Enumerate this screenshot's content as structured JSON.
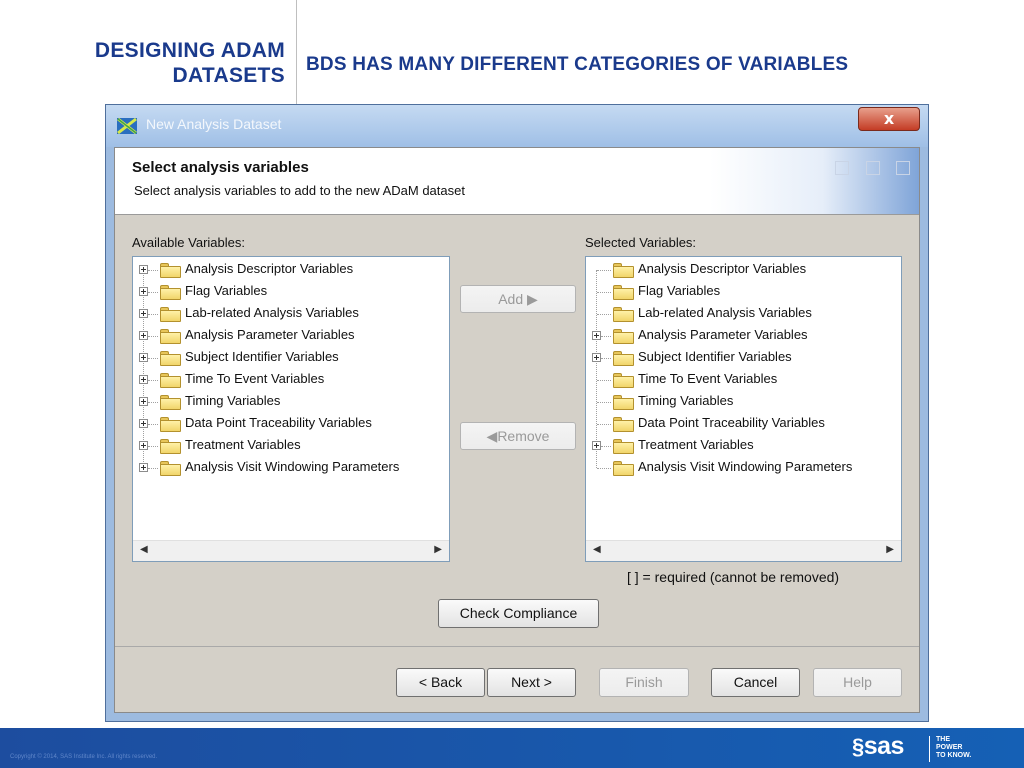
{
  "slide": {
    "left_title_line1": "DESIGNING ADAM",
    "left_title_line2": "DATASETS",
    "right_title": "BDS HAS MANY DIFFERENT CATEGORIES OF VARIABLES",
    "copyright": "Copyright © 2014, SAS Institute Inc. All rights reserved.",
    "logo_text": "sas",
    "tagline_line1": "THE",
    "tagline_line2": "POWER",
    "tagline_line3": "TO KNOW."
  },
  "window": {
    "title": "New Analysis Dataset",
    "close_label": "x"
  },
  "banner": {
    "title": "Select analysis variables",
    "subtitle": "Select analysis variables to add to the new ADaM dataset"
  },
  "available": {
    "label": "Available Variables:",
    "items": [
      {
        "label": "Analysis Descriptor Variables",
        "expandable": true
      },
      {
        "label": "Flag Variables",
        "expandable": true
      },
      {
        "label": "Lab-related Analysis Variables",
        "expandable": true
      },
      {
        "label": "Analysis Parameter Variables",
        "expandable": true
      },
      {
        "label": "Subject Identifier Variables",
        "expandable": true
      },
      {
        "label": "Time To Event Variables",
        "expandable": true
      },
      {
        "label": "Timing Variables",
        "expandable": true
      },
      {
        "label": "Data Point Traceability Variables",
        "expandable": true
      },
      {
        "label": "Treatment Variables",
        "expandable": true
      },
      {
        "label": "Analysis Visit Windowing Parameters",
        "expandable": true
      }
    ]
  },
  "selected": {
    "label": "Selected Variables:",
    "items": [
      {
        "label": "Analysis Descriptor Variables",
        "expandable": false
      },
      {
        "label": "Flag Variables",
        "expandable": false
      },
      {
        "label": "Lab-related Analysis Variables",
        "expandable": false
      },
      {
        "label": "Analysis Parameter Variables",
        "expandable": true
      },
      {
        "label": "Subject Identifier Variables",
        "expandable": true
      },
      {
        "label": "Time To Event Variables",
        "expandable": false
      },
      {
        "label": "Timing Variables",
        "expandable": false
      },
      {
        "label": "Data Point Traceability Variables",
        "expandable": false
      },
      {
        "label": "Treatment Variables",
        "expandable": true
      },
      {
        "label": "Analysis Visit Windowing Parameters",
        "expandable": false
      }
    ],
    "note": "[ ] = required (cannot be removed)"
  },
  "buttons": {
    "add": "Add ▶",
    "remove": "◀Remove",
    "check_compliance": "Check Compliance",
    "back": "< Back",
    "next": "Next >",
    "finish": "Finish",
    "cancel": "Cancel",
    "help": "Help"
  },
  "colors": {
    "slide_title": "#1a3a8c",
    "footer": "#1d4d9f",
    "folder": "#f1d56a"
  }
}
